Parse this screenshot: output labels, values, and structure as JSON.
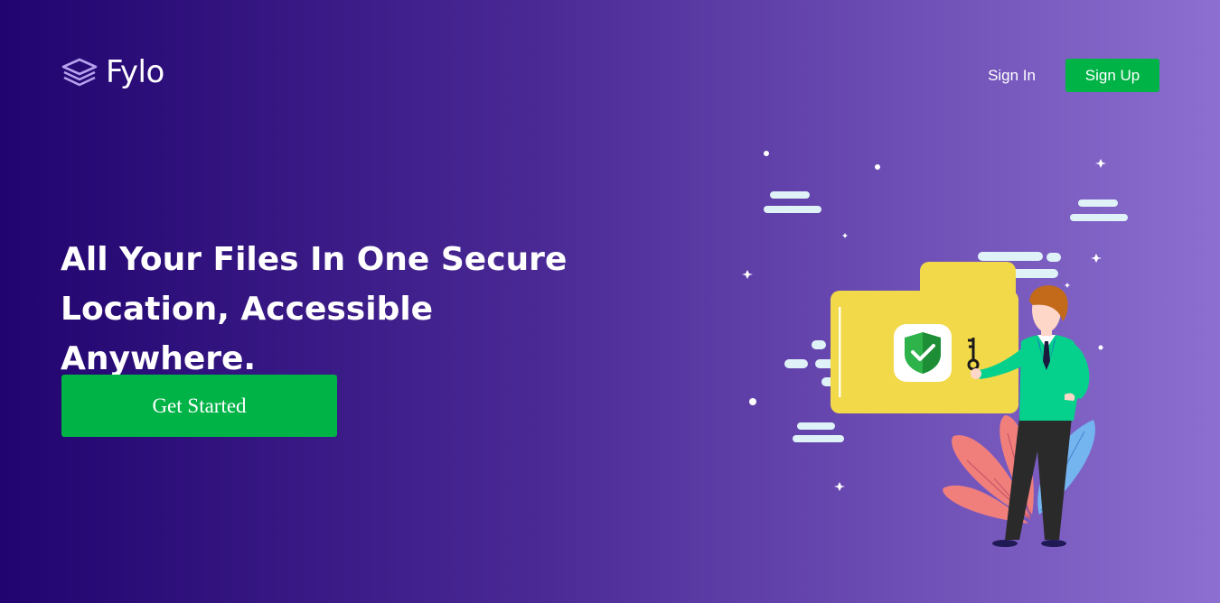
{
  "header": {
    "logo_text": "Fylo",
    "logo_icon": "stacked-layers-icon",
    "nav": {
      "sign_in_label": "Sign In",
      "sign_up_label": "Sign Up"
    }
  },
  "hero": {
    "headline": "All Your Files In One Secure Location, Accessible Anywhere.",
    "cta_label": "Get Started",
    "illustration_icons": [
      "folder-icon",
      "shield-check-icon",
      "key-icon",
      "person-icon",
      "cloud-icon",
      "leaf-icon",
      "sparkle-icon"
    ]
  },
  "colors": {
    "background_start": "#21046f",
    "background_end": "#8c6fd0",
    "accent_green": "#00b346",
    "folder_yellow": "#f2d94a",
    "shield_green": "#2db34a",
    "shirt_teal": "#05d18c"
  }
}
